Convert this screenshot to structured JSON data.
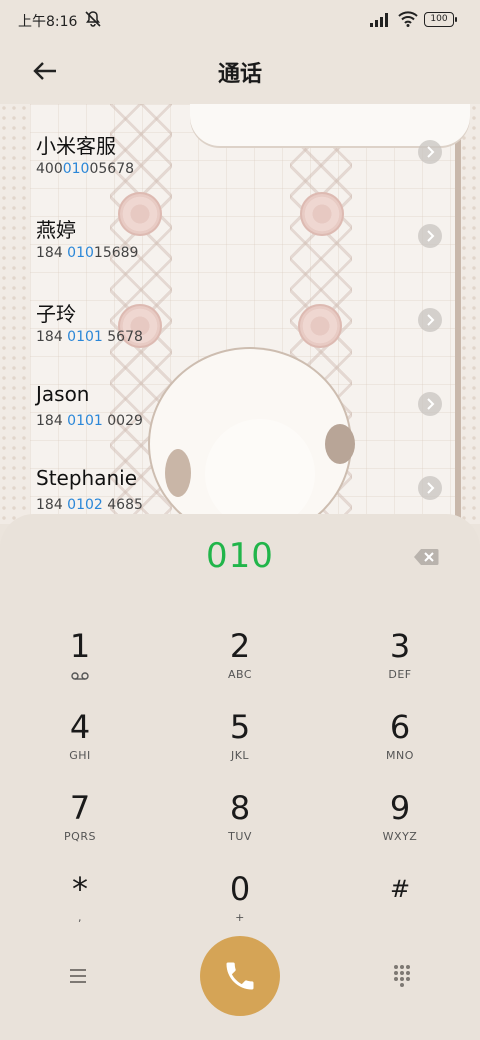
{
  "status_bar": {
    "time": "上午8:16",
    "battery": "100"
  },
  "header": {
    "title": "通话"
  },
  "contacts": [
    {
      "name": "小米客服",
      "number_pre": "400",
      "number_hl": "010",
      "number_post": "05678"
    },
    {
      "name": "燕婷",
      "number_pre": "184 ",
      "number_hl": "010",
      "number_post": "15689"
    },
    {
      "name": "子玲",
      "number_pre": "184 ",
      "number_hl": "0101",
      "number_post": " 5678"
    },
    {
      "name": "Jason",
      "number_pre": "184 ",
      "number_hl": "0101",
      "number_post": " 0029"
    },
    {
      "name": "Stephanie",
      "number_pre": "184 ",
      "number_hl": "0102",
      "number_post": " 4685"
    }
  ],
  "dialer": {
    "typed": "010",
    "keys": [
      {
        "digit": "1",
        "sub": ""
      },
      {
        "digit": "2",
        "sub": "ABC"
      },
      {
        "digit": "3",
        "sub": "DEF"
      },
      {
        "digit": "4",
        "sub": "GHI"
      },
      {
        "digit": "5",
        "sub": "JKL"
      },
      {
        "digit": "6",
        "sub": "MNO"
      },
      {
        "digit": "7",
        "sub": "PQRS"
      },
      {
        "digit": "8",
        "sub": "TUV"
      },
      {
        "digit": "9",
        "sub": "WXYZ"
      },
      {
        "digit": "*",
        "sub": ","
      },
      {
        "digit": "0",
        "sub": "+"
      },
      {
        "digit": "#",
        "sub": ""
      }
    ]
  },
  "colors": {
    "accent_green": "#21b54a",
    "highlight_blue": "#2b87d8",
    "call_button": "#d5a456"
  },
  "icons": [
    "mute-icon",
    "signal-icon",
    "wifi-icon",
    "battery-icon",
    "back-arrow-icon",
    "chevron-right-icon",
    "backspace-icon",
    "voicemail-icon",
    "menu-icon",
    "phone-icon",
    "dialpad-icon"
  ]
}
